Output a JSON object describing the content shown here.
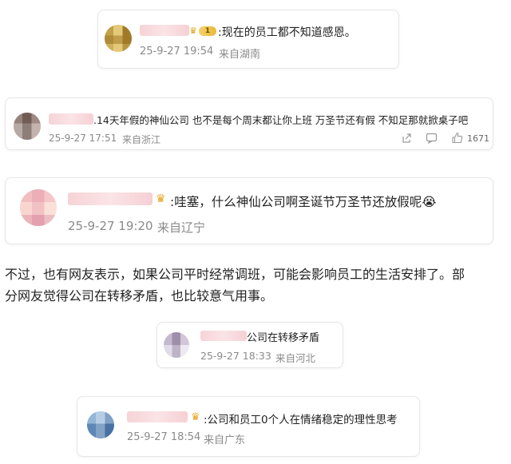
{
  "comments": [
    {
      "text": ":现在的员工都不知道感恩。",
      "time": "25-9-27 19:54",
      "location": "来自湖南",
      "level": "1"
    },
    {
      "text": ".14天年假的神仙公司 也不是每个周末都让你上班  万圣节还有假 不知足那就掀桌子吧",
      "time": "25-9-27 17:51",
      "location": "来自浙江",
      "like_count": "1671"
    },
    {
      "text": ":哇塞，什么神仙公司啊圣诞节万圣节还放假呢😭",
      "time": "25-9-27 19:20",
      "location": "来自辽宁"
    },
    {
      "text": "公司在转移矛盾",
      "time": "25-9-27 18:33",
      "location": "来自河北"
    },
    {
      "text": ":公司和员工0个人在情绪稳定的理性思考",
      "time": "25-9-27 18:54",
      "location": "来自广东"
    }
  ],
  "article": {
    "line1": "不过，也有网友表示，如果公司平时经常调班，可能会影响员工的生活安排了。部",
    "line2": "分网友觉得公司在转移矛盾，也比较意气用事。"
  },
  "icons": {
    "share": "share-icon",
    "comment": "comment-icon",
    "like": "thumbs-up-icon",
    "crown": "crown-badge-icon"
  },
  "colors": {
    "meta_text": "#8a8a8a",
    "card_border": "#e6e6e6",
    "name_blur": "#f6d3d6"
  }
}
